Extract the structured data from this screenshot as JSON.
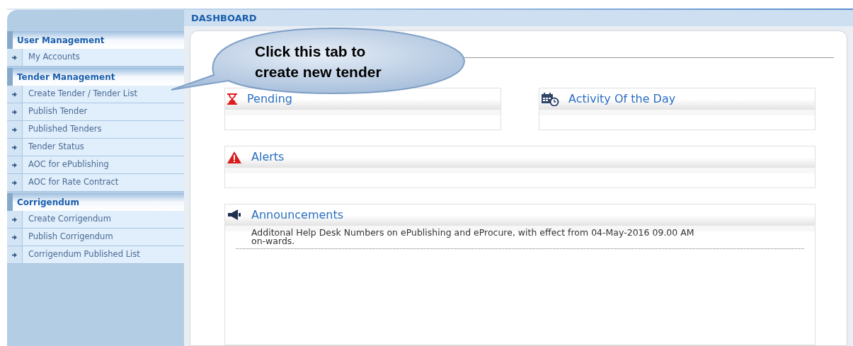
{
  "sidebar": {
    "sections": [
      {
        "title": "User Management",
        "items": [
          "My Accounts"
        ]
      },
      {
        "title": "Tender Management",
        "items": [
          "Create Tender / Tender List",
          "Publish Tender",
          "Published Tenders",
          "Tender Status",
          "AOC for ePublishing",
          "AOC for Rate Contract"
        ]
      },
      {
        "title": "Corrigendum",
        "items": [
          "Create Corrigendum",
          "Publish Corrigendum",
          "Corrigendum Published List"
        ]
      }
    ]
  },
  "header": {
    "title": "DASHBOARD"
  },
  "callout": {
    "lines": [
      "Click this tab to",
      "create new tender"
    ]
  },
  "panels": [
    {
      "kind": "pending",
      "title": "Pending"
    },
    {
      "kind": "activity",
      "title": "Activity Of the Day"
    },
    {
      "kind": "alerts",
      "title": "Alerts"
    },
    {
      "kind": "announcements",
      "title": "Announcements",
      "entries": [
        "Additonal Help Desk Numbers on ePublishing and eProcure, with effect from 04-May-2016 09.00 AM on-wards."
      ]
    }
  ]
}
